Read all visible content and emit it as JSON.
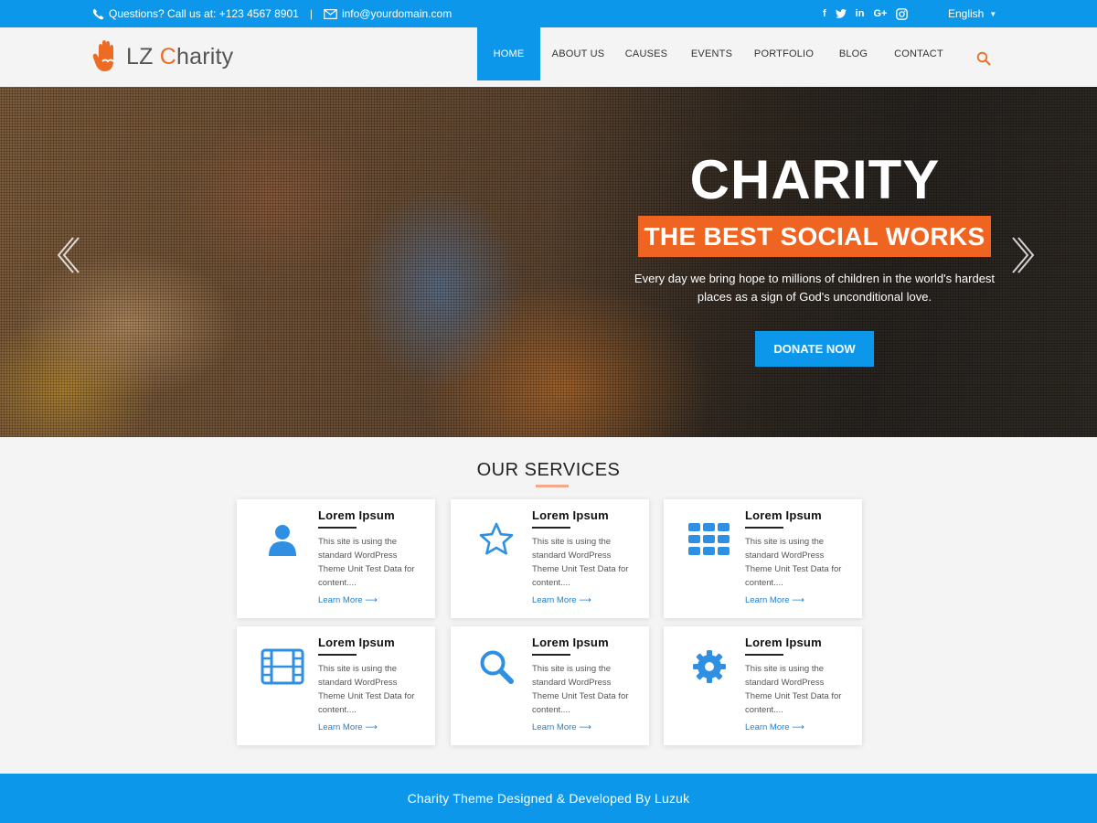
{
  "topbar": {
    "phone_text": "Questions? Call us at: +123 4567 8901",
    "separator": "|",
    "email_text": "info@yourdomain.com",
    "social": [
      "f",
      "t",
      "in",
      "G+",
      "ig"
    ],
    "language": "English"
  },
  "header": {
    "logo_prefix": "LZ ",
    "logo_accent": "C",
    "logo_rest": "harity",
    "nav": [
      "HOME",
      "ABOUT US",
      "CAUSES",
      "EVENTS",
      "PORTFOLIO",
      "BLOG",
      "CONTACT"
    ],
    "active_nav": "HOME"
  },
  "hero": {
    "title": "CHARITY",
    "badge": "THE BEST SOCIAL WORKS",
    "description": "Every day we bring hope to millions of children in the world's hardest places as a sign of God's unconditional love.",
    "button": "DONATE NOW"
  },
  "services": {
    "title": "OUR SERVICES",
    "cards": [
      {
        "icon": "user-icon",
        "title": "Lorem Ipsum",
        "text": "This site is using the standard WordPress Theme Unit Test Data for content....",
        "more": "Learn More ⟶"
      },
      {
        "icon": "star-icon",
        "title": "Lorem Ipsum",
        "text": "This site is using the standard WordPress Theme Unit Test Data for content....",
        "more": "Learn More ⟶"
      },
      {
        "icon": "grid-icon",
        "title": "Lorem Ipsum",
        "text": "This site is using the standard WordPress Theme Unit Test Data for content....",
        "more": "Learn More ⟶"
      },
      {
        "icon": "film-icon",
        "title": "Lorem Ipsum",
        "text": "This site is using the standard WordPress Theme Unit Test Data for content....",
        "more": "Learn More ⟶"
      },
      {
        "icon": "search-icon",
        "title": "Lorem Ipsum",
        "text": "This site is using the standard WordPress Theme Unit Test Data for content....",
        "more": "Learn More ⟶"
      },
      {
        "icon": "gear-icon",
        "title": "Lorem Ipsum",
        "text": "This site is using the standard WordPress Theme Unit Test Data for content....",
        "more": "Learn More ⟶"
      }
    ]
  },
  "footer": {
    "text": "Charity Theme Designed & Developed By Luzuk"
  },
  "colors": {
    "primary_blue": "#0d97ea",
    "accent_orange": "#ef6421",
    "icon_blue": "#2f8fe3"
  }
}
